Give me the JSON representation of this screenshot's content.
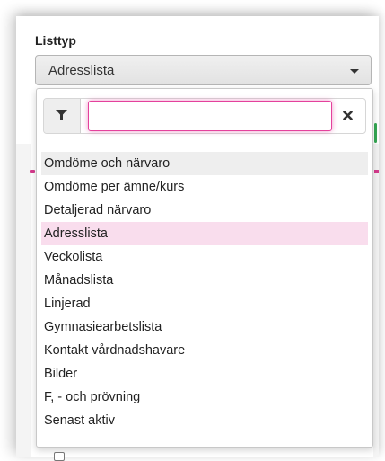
{
  "field": {
    "label": "Listtyp",
    "selected_value": "Adresslista"
  },
  "search": {
    "value": "",
    "placeholder": "",
    "filter_icon": "filter-icon",
    "clear_icon": "close-icon"
  },
  "options": [
    "Omdöme och närvaro",
    "Omdöme per ämne/kurs",
    "Detaljerad närvaro",
    "Adresslista",
    "Veckolista",
    "Månadslista",
    "Linjerad",
    "Gymnasiearbetslista",
    "Kontakt vårdnadshavare",
    "Bilder",
    "F, - och prövning",
    "Senast aktiv"
  ],
  "hovered_index": 0,
  "selected_index": 3,
  "colors": {
    "focus_border": "#e4419c",
    "selected_bg": "#f9dded",
    "hover_bg": "#eeeeee"
  }
}
